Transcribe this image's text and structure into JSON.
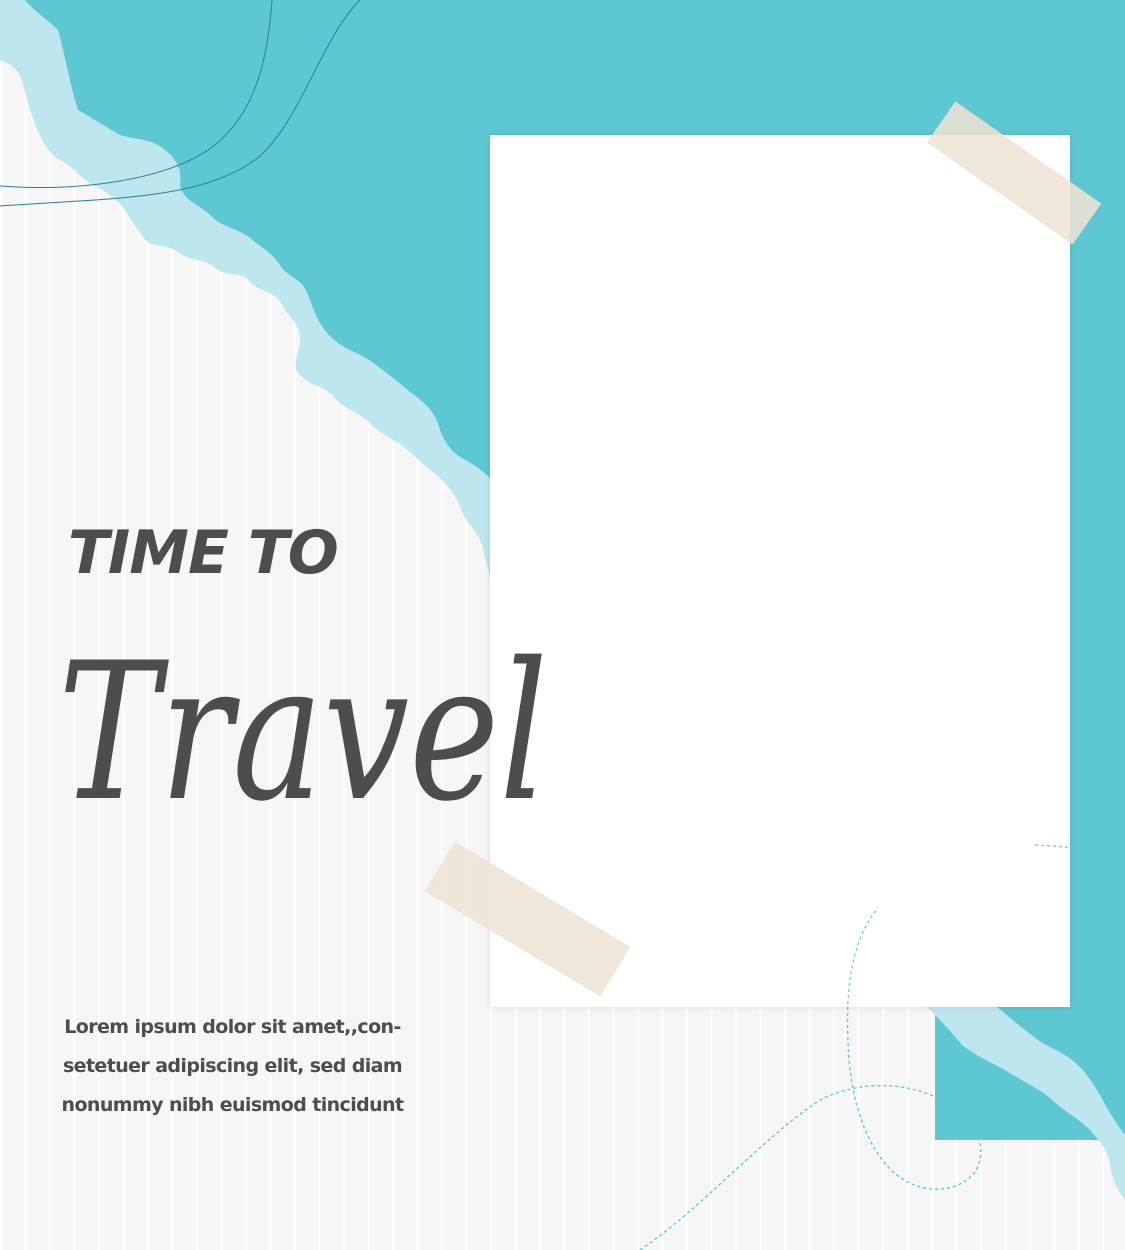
{
  "poster": {
    "headline_small": "TIME TO",
    "headline_script": "Travel",
    "body_lines": [
      "Lorem ipsum dolor sit amet,,con-",
      "setetuer adipiscing elit, sed diam",
      "nonummy nibh euismod tincidunt"
    ]
  },
  "colors": {
    "background": "#f6f6f6",
    "sea_teal": "#5ec7d4",
    "sea_light": "#bde6ef",
    "tape": "#eee2d4",
    "text": "#4d4d4d",
    "frame": "#ffffff"
  },
  "icons": {
    "tape_top": "washi-tape-icon",
    "tape_bottom": "washi-tape-icon"
  }
}
